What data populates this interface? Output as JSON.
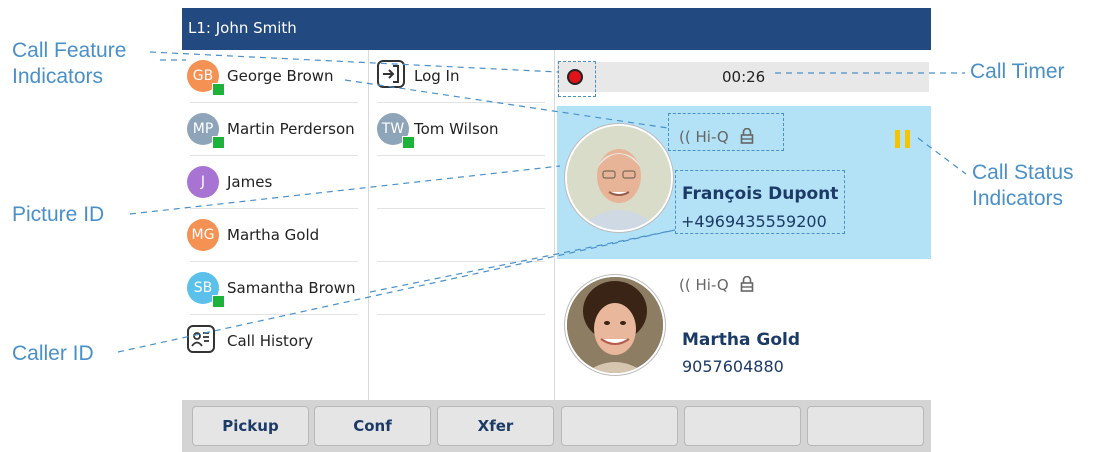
{
  "titlebar": {
    "line_label": "L1: John Smith"
  },
  "contacts_col1": [
    {
      "initials": "GB",
      "name": "George Brown",
      "avatar_color": "#f59152",
      "presence": true
    },
    {
      "initials": "MP",
      "name": "Martin Perderson",
      "avatar_color": "#8ea4b8",
      "presence": true
    },
    {
      "initials": "J",
      "name": "James",
      "avatar_color": "#a774d4",
      "presence": false
    },
    {
      "initials": "MG",
      "name": "Martha Gold",
      "avatar_color": "#f59152",
      "presence": false
    },
    {
      "initials": "SB",
      "name": "Samantha Brown",
      "avatar_color": "#5bc0ea",
      "presence": true
    }
  ],
  "call_history": {
    "label": "Call History",
    "icon": "call-history-icon"
  },
  "col2": {
    "login": {
      "label": "Log In",
      "icon": "login-icon"
    },
    "contact": {
      "initials": "TW",
      "name": "Tom Wilson",
      "avatar_color": "#8ea4b8",
      "presence": true
    }
  },
  "call_timer": {
    "value": "00:26"
  },
  "active_call": {
    "feature": "Hi-Q",
    "name": "François Dupont",
    "number": "+4969435559200",
    "status_icon": "hold-icon",
    "status_color": "#f5c400"
  },
  "second_call": {
    "feature": "Hi-Q",
    "name": "Martha Gold",
    "number": "9057604880"
  },
  "softkeys": [
    "Pickup",
    "Conf",
    "Xfer",
    "",
    "",
    ""
  ],
  "callouts": {
    "feature_line1": "Call Feature",
    "feature_line2": "Indicators",
    "picture_id": "Picture ID",
    "caller_id": "Caller ID",
    "call_timer": "Call Timer",
    "status_line1": "Call Status",
    "status_line2": "Indicators"
  },
  "colors": {
    "title_bg": "#234a80",
    "active_call_bg": "#b3e2f7",
    "callout": "#4a90c8",
    "record": "#e0131b"
  }
}
